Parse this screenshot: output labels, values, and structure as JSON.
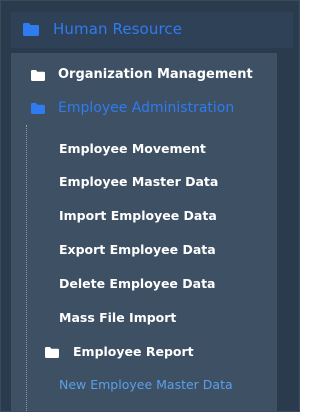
{
  "colors": {
    "background": "#2b3b4e",
    "panel": "#3e5064",
    "active": "#2f7bf0",
    "link": "#5aa0e8",
    "text": "#ffffff"
  },
  "nav": {
    "top": {
      "label": "Human Resource",
      "icon": "folder-icon"
    },
    "items": [
      {
        "label": "Organization Management",
        "icon": "folder-icon"
      },
      {
        "label": "Employee Administration",
        "icon": "folder-icon",
        "active": true
      }
    ],
    "employee_admin_children": [
      "Employee Movement",
      "Employee Master Data",
      "Import Employee Data",
      "Export Employee Data",
      "Delete Employee Data",
      "Mass File Import"
    ],
    "employee_report": {
      "label": "Employee Report",
      "icon": "folder-icon"
    },
    "link_item": "New Employee Master Data"
  }
}
